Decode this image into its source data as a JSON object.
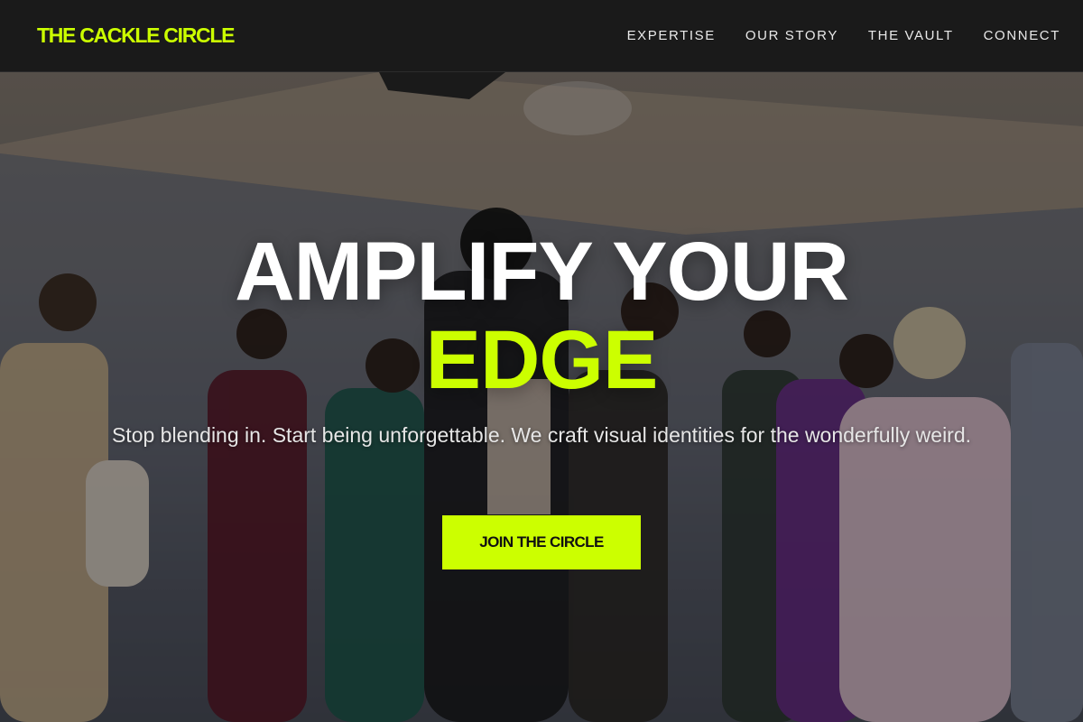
{
  "brand": {
    "name": "THE CACKLE CIRCLE",
    "accent_color": "#ccff00"
  },
  "nav": {
    "links": [
      "EXPERTISE",
      "OUR STORY",
      "THE VAULT",
      "CONNECT"
    ]
  },
  "hero": {
    "title_line_1": "AMPLIFY YOUR",
    "title_line_2": "EDGE",
    "subtitle": "Stop blending in. Start being unforgettable. We craft visual identities for the wonderfully weird.",
    "cta_label": "JOIN THE CIRCLE",
    "background_image": "group of people in avant-garde fashion posing in a studio"
  }
}
